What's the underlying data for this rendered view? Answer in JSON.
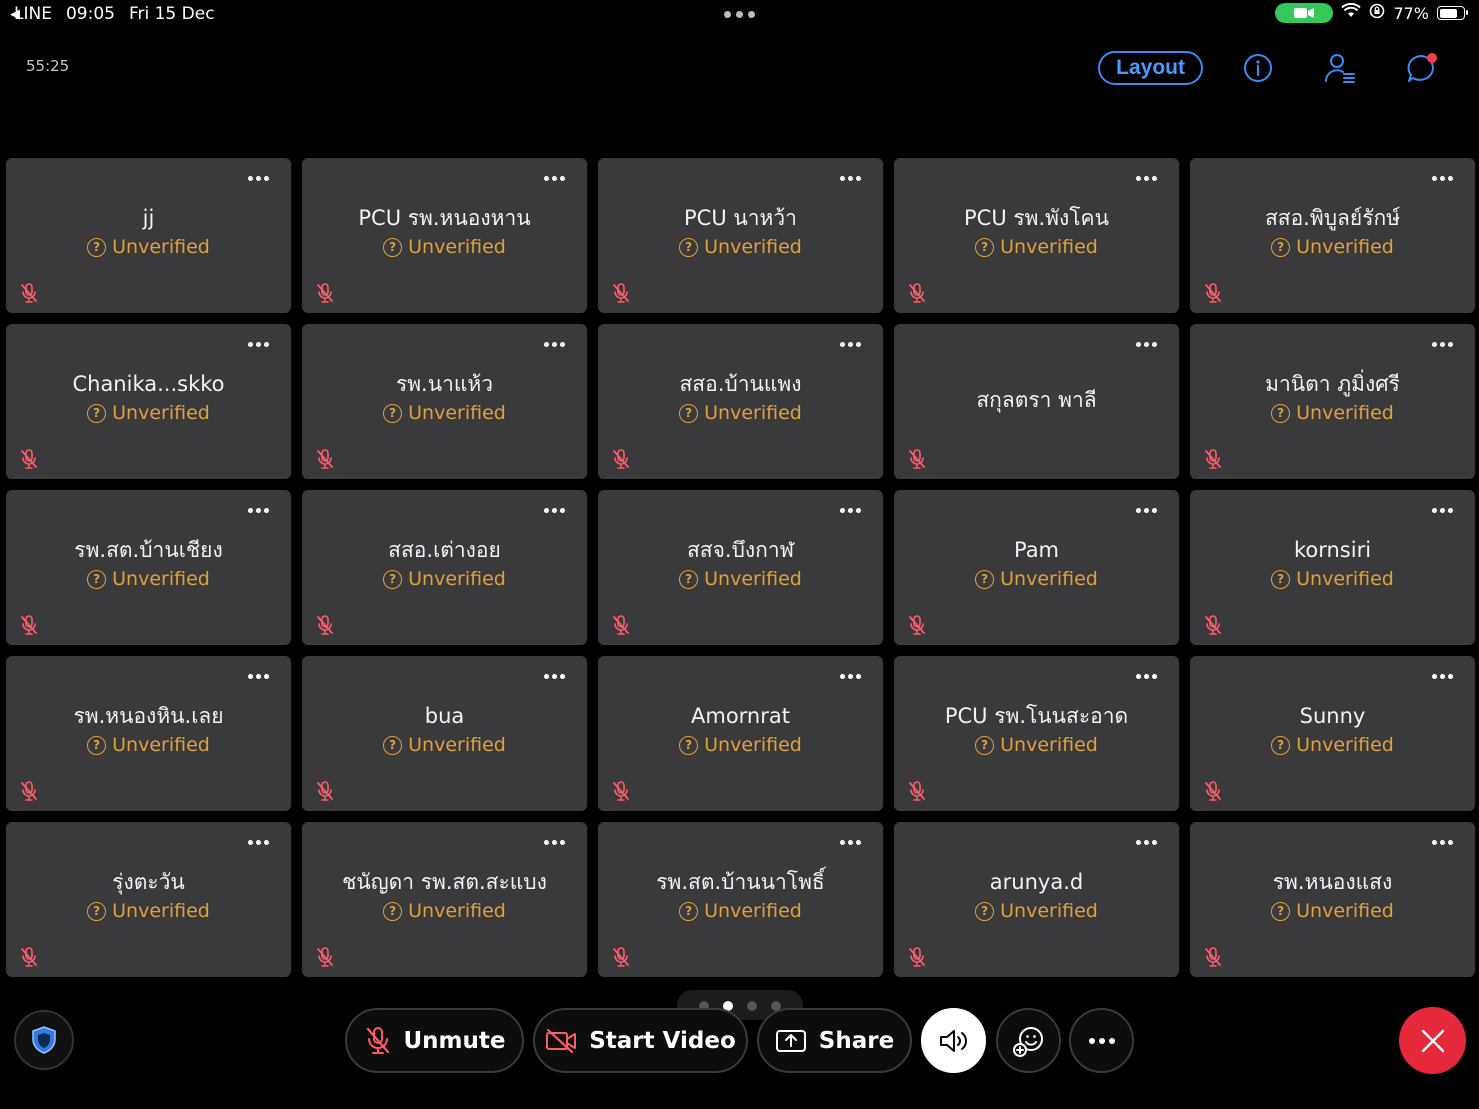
{
  "status_bar": {
    "back_app": "LINE",
    "time": "09:05",
    "date": "Fri 15 Dec",
    "battery": "77%",
    "battery_level": 0.77
  },
  "header": {
    "timer": "55:25",
    "layout_label": "Layout"
  },
  "participants": [
    {
      "name": "jj",
      "status": "Unverified"
    },
    {
      "name": "PCU รพ.หนองหาน",
      "status": "Unverified"
    },
    {
      "name": "PCU นาหว้า",
      "status": "Unverified"
    },
    {
      "name": "PCU รพ.พังโคน",
      "status": "Unverified"
    },
    {
      "name": "สสอ.พิบูลย์รักษ์",
      "status": "Unverified"
    },
    {
      "name": "Chanika...skko",
      "status": "Unverified"
    },
    {
      "name": "รพ.นาแห้ว",
      "status": "Unverified"
    },
    {
      "name": "สสอ.บ้านแพง",
      "status": "Unverified"
    },
    {
      "name": "สกุลตรา  พาลี",
      "status": ""
    },
    {
      "name": "มานิตา ภูมิ่งศรี",
      "status": "Unverified"
    },
    {
      "name": "รพ.สต.บ้านเชียง",
      "status": "Unverified"
    },
    {
      "name": "สสอ.เต่างอย",
      "status": "Unverified"
    },
    {
      "name": "สสจ.บึงกาฬ",
      "status": "Unverified"
    },
    {
      "name": "Pam",
      "status": "Unverified"
    },
    {
      "name": "kornsiri",
      "status": "Unverified"
    },
    {
      "name": "รพ.หนองหิน.เลย",
      "status": "Unverified"
    },
    {
      "name": "bua",
      "status": "Unverified"
    },
    {
      "name": "Amornrat",
      "status": "Unverified"
    },
    {
      "name": "PCU รพ.โนนสะอาด",
      "status": "Unverified"
    },
    {
      "name": "Sunny",
      "status": "Unverified"
    },
    {
      "name": "รุ่งตะวัน",
      "status": "Unverified"
    },
    {
      "name": "ชนัญดา รพ.สต.สะแบง",
      "status": "Unverified"
    },
    {
      "name": "รพ.สต.บ้านนาโพธิ์",
      "status": "Unverified"
    },
    {
      "name": "arunya.d",
      "status": "Unverified"
    },
    {
      "name": "รพ.หนองแสง",
      "status": "Unverified"
    }
  ],
  "pager": {
    "pages": 4,
    "current": 2
  },
  "controls": {
    "unmute_label": "Unmute",
    "start_video_label": "Start Video",
    "share_label": "Share"
  },
  "colors": {
    "accent": "#3a8cf5",
    "unverified": "#e0a03a",
    "tile": "#3a3a3c",
    "end_call": "#e5293a",
    "camera_pill": "#34c759"
  }
}
